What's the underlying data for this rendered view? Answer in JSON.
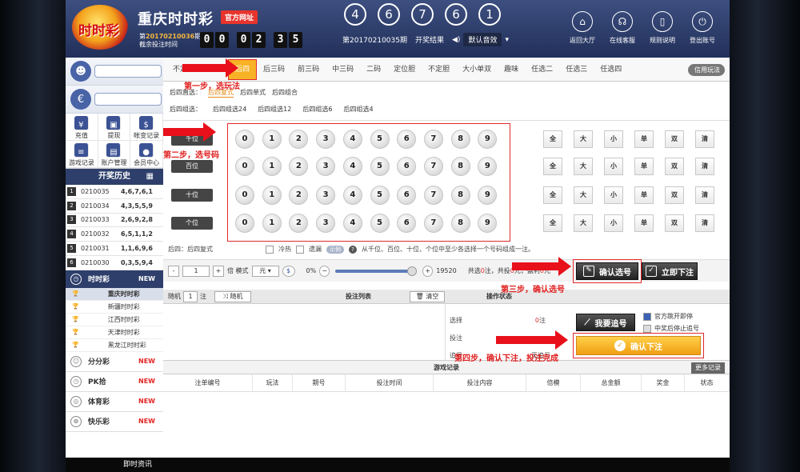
{
  "header": {
    "logo_text": "时时彩",
    "title": "重庆时时彩",
    "official": "官方网址",
    "period_prefix": "第",
    "period": "20170210036",
    "period_suffix": "期",
    "remain_label": "截余投注时间",
    "timer": [
      "0",
      "0",
      "0",
      "2",
      "3",
      "5"
    ],
    "balls": [
      "4",
      "6",
      "7",
      "6",
      "1"
    ],
    "draw_period": "第20170210035期",
    "draw_result": "开奖结果",
    "sound": "默认音效",
    "nav": [
      {
        "label": "返回大厅",
        "icon": "home-icon"
      },
      {
        "label": "在线客服",
        "icon": "headset-icon"
      },
      {
        "label": "规则说明",
        "icon": "phone-icon"
      },
      {
        "label": "登出账号",
        "icon": "power-icon"
      }
    ]
  },
  "left": {
    "quick": [
      {
        "label": "充值",
        "icon": "¥"
      },
      {
        "label": "提现",
        "icon": "▣"
      },
      {
        "label": "帐变记录",
        "icon": "$"
      },
      {
        "label": "游戏记录",
        "icon": "≡"
      },
      {
        "label": "账户管理",
        "icon": "▤"
      },
      {
        "label": "会员中心",
        "icon": "●"
      }
    ],
    "history_title": "开奖历史",
    "history": [
      {
        "n": "1",
        "period": "0210035",
        "result": "4,6,7,6,1"
      },
      {
        "n": "2",
        "period": "0210034",
        "result": "4,3,5,5,9"
      },
      {
        "n": "3",
        "period": "0210033",
        "result": "2,6,9,2,8"
      },
      {
        "n": "4",
        "period": "0210032",
        "result": "6,5,1,1,2"
      },
      {
        "n": "5",
        "period": "0210031",
        "result": "1,1,6,9,6"
      },
      {
        "n": "6",
        "period": "0210030",
        "result": "0,3,5,9,4"
      }
    ],
    "ssc_label": "时时彩",
    "new": "NEW",
    "ssc_subs": [
      "重庆时时彩",
      "新疆时时彩",
      "江西时时彩",
      "天津时时彩",
      "黑龙江时时彩"
    ],
    "other_lots": [
      {
        "label": "分分彩",
        "icon": "☺"
      },
      {
        "label": "PK拾",
        "icon": "◷"
      },
      {
        "label": "体育彩",
        "icon": "◎"
      },
      {
        "label": "快乐彩",
        "icon": "⊜"
      }
    ]
  },
  "tabs": [
    "不定位",
    "五星",
    "后四",
    "后三码",
    "前三码",
    "中三码",
    "二码",
    "定位胆",
    "不定胆",
    "大小单双",
    "趣味",
    "任选二",
    "任选三",
    "任选四"
  ],
  "credit": "信用玩法",
  "ways": {
    "direct_label": "后四直选：",
    "direct": [
      "后四复式",
      "后四单式",
      "后四组合"
    ],
    "group_label": "后四组选：",
    "group": [
      "后四组选24",
      "后四组选12",
      "后四组选6",
      "后四组选4"
    ]
  },
  "positions": [
    "千位",
    "百位",
    "十位",
    "个位"
  ],
  "digits": [
    "0",
    "1",
    "2",
    "3",
    "4",
    "5",
    "6",
    "7",
    "8",
    "9"
  ],
  "quick_select": [
    "全",
    "大",
    "小",
    "单",
    "双",
    "清"
  ],
  "rule": {
    "prefix": "后四：后四复式",
    "hot": "冷热",
    "miss": "遗漏",
    "sample": "示例",
    "text": "从千位、百位、十位、个位中至少各选择一个号码组成一注。"
  },
  "bet": {
    "minus": "-",
    "times": "1",
    "plus": "+",
    "times_label": "倍 模式",
    "mode": "元",
    "pct": "0%",
    "pct_minus": "−",
    "pct_plus": "+",
    "prize": "19520",
    "summary_a": "共选",
    "count": "0",
    "summary_b": "注，共投",
    "amount": "0",
    "summary_c": "元，盈利",
    "profit": "0",
    "summary_d": "元"
  },
  "buttons": {
    "confirm": "确认选号",
    "instant": "立即下注",
    "chase": "我要追号",
    "submit": "确认下注",
    "random": "随机",
    "clear": "清空",
    "more": "更多记录"
  },
  "list": {
    "random_prefix": "随机",
    "random_n": "1",
    "random_unit": "注",
    "bet_list": "投注列表",
    "op": "操作状态"
  },
  "stats": {
    "select_label": "选择",
    "select_val": "0",
    "select_unit": "注",
    "select_val2": "0",
    "select_unit2": "单",
    "bet_label": "投注",
    "chase_label": "追号",
    "chase_val": "无追号"
  },
  "checks": [
    "官方跳开即停",
    "中奖后停止追号"
  ],
  "game_log": "游戏记录",
  "columns": [
    "注单编号",
    "玩法",
    "期号",
    "投注时间",
    "投注内容",
    "倍模",
    "总金额",
    "奖金",
    "状态"
  ],
  "annotations": [
    "第一步，选玩法",
    "第二步，选号码",
    "第三步，确认选号",
    "第四步，确认下注，投注完成"
  ],
  "footer": "即时资讯"
}
